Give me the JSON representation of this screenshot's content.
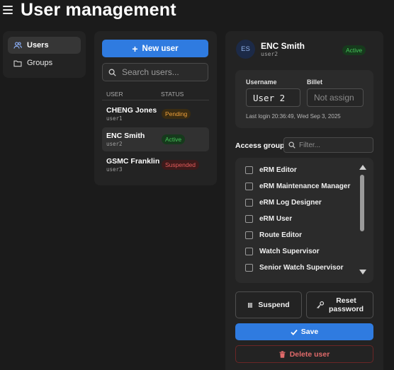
{
  "header": {
    "title": "User management",
    "menu_icon": "hamburger-menu-icon"
  },
  "nav": {
    "items": [
      {
        "label": "Users",
        "icon": "users-icon",
        "active": true
      },
      {
        "label": "Groups",
        "icon": "folder-icon",
        "active": false
      }
    ]
  },
  "users_list": {
    "new_user_label": "New user",
    "search_placeholder": "Search users...",
    "columns": [
      "USER",
      "STATUS"
    ],
    "rows": [
      {
        "full_name": "CHENG Jones",
        "username": "user1",
        "status": "Pending"
      },
      {
        "full_name": "ENC Smith",
        "username": "user2",
        "status": "Active",
        "selected": true
      },
      {
        "full_name": "GSMC Franklin",
        "username": "user3",
        "status": "Suspended"
      }
    ]
  },
  "detail": {
    "avatar_initials": "ES",
    "full_name": "ENC Smith",
    "username": "user2",
    "status": "Active",
    "username_label": "Username",
    "username_value": "User 2",
    "billet_label": "Billet",
    "billet_placeholder": "Not assign",
    "last_login": "Last login 20:36:49, Wed Sep 3, 2025",
    "access_groups_label": "Access groups",
    "filter_placeholder": "Filter...",
    "access_groups": [
      "eRM Editor",
      "eRM Maintenance Manager",
      "eRM Log Designer",
      "eRM User",
      "Route Editor",
      "Watch Supervisor",
      "Senior Watch Supervisor"
    ],
    "suspend_label": "Suspend",
    "reset_password_label": "Reset\npassword",
    "save_label": "Save",
    "delete_label": "Delete user"
  },
  "colors": {
    "background": "#1b1b1b",
    "panel": "#232323",
    "accent": "#2f7be0",
    "active": "#47c45a",
    "pending": "#f0a23c",
    "suspended": "#e45c5c"
  }
}
